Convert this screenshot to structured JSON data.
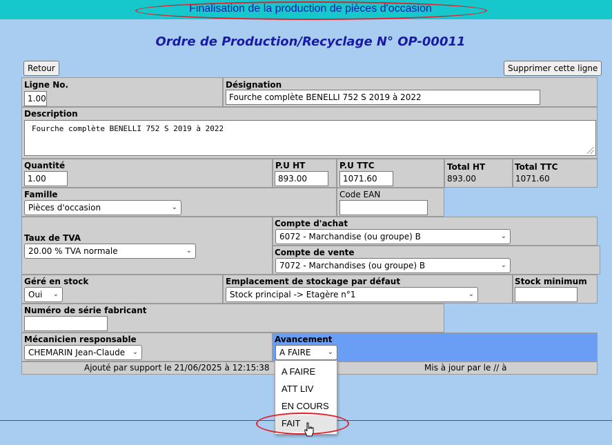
{
  "header": {
    "banner": "Finalisation de la production de pièces d'occasion",
    "title": "Ordre de Production/Recyclage N° OP-00011"
  },
  "toolbar": {
    "back_label": "Retour",
    "delete_label": "Supprimer cette ligne"
  },
  "form": {
    "line_no": {
      "label": "Ligne No.",
      "value": "1.00"
    },
    "designation": {
      "label": "Désignation",
      "value": "Fourche complète BENELLI 752 S 2019 à 2022"
    },
    "description": {
      "label": "Description",
      "value": "Fourche complète BENELLI 752 S 2019 à 2022"
    },
    "quantity": {
      "label": "Quantité",
      "value": "1.00"
    },
    "pu_ht": {
      "label": "P.U HT",
      "value": "893.00"
    },
    "pu_ttc": {
      "label": "P.U TTC",
      "value": "1071.60"
    },
    "total_ht": {
      "label": "Total HT",
      "value": "893.00"
    },
    "total_ttc": {
      "label": "Total TTC",
      "value": "1071.60"
    },
    "famille": {
      "label": "Famille",
      "value": "Pièces d'occasion"
    },
    "code_ean": {
      "label": "Code EAN",
      "value": ""
    },
    "taux_tva": {
      "label": "Taux de TVA",
      "value": "20.00 % TVA normale"
    },
    "compte_achat": {
      "label": "Compte d'achat",
      "value": "6072 - Marchandise (ou groupe) B"
    },
    "compte_vente": {
      "label": "Compte de vente",
      "value": "7072 - Marchandises (ou groupe) B"
    },
    "gere_stock": {
      "label": "Géré en stock",
      "value": "Oui"
    },
    "emplacement": {
      "label": "Emplacement de stockage par défaut",
      "value": "Stock principal -> Etagère n°1"
    },
    "stock_min": {
      "label": "Stock minimum",
      "value": ""
    },
    "serie": {
      "label": "Numéro de série fabricant",
      "value": ""
    },
    "mecanicien": {
      "label": "Mécanicien responsable",
      "value": "CHEMARIN Jean-Claude"
    },
    "avancement": {
      "label": "Avancement",
      "value": "A FAIRE"
    }
  },
  "footer": {
    "added": "Ajouté par support le 21/06/2025 à 12:15:38",
    "updated": "Mis à jour par le // à"
  },
  "dropdown": {
    "options": [
      "A FAIRE",
      "ATT LIV",
      "EN COURS",
      "FAIT"
    ],
    "hovered": "FAIT"
  },
  "colors": {
    "background": "#a8cdf0",
    "banner": "#16c8cc",
    "title": "#1a1aa6",
    "highlight": "#6a9ef5",
    "annotation": "#e0202a"
  }
}
